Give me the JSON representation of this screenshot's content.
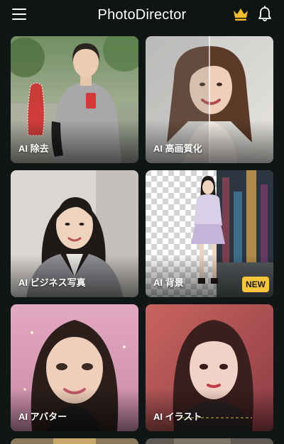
{
  "header": {
    "title": "PhotoDirector",
    "menu_icon": "hamburger-menu-icon",
    "premium_icon": "crown-icon",
    "notification_icon": "bell-icon"
  },
  "colors": {
    "background": "#101516",
    "badge": "#f7c53b",
    "crown": "#f2bd2c"
  },
  "features": [
    {
      "label": "AI 除去"
    },
    {
      "label": "AI 高画質化"
    },
    {
      "label": "AI ビジネス写真"
    },
    {
      "label": "AI 背景",
      "badge": "NEW"
    },
    {
      "label": "AI アバター"
    },
    {
      "label": "AI イラスト"
    }
  ]
}
